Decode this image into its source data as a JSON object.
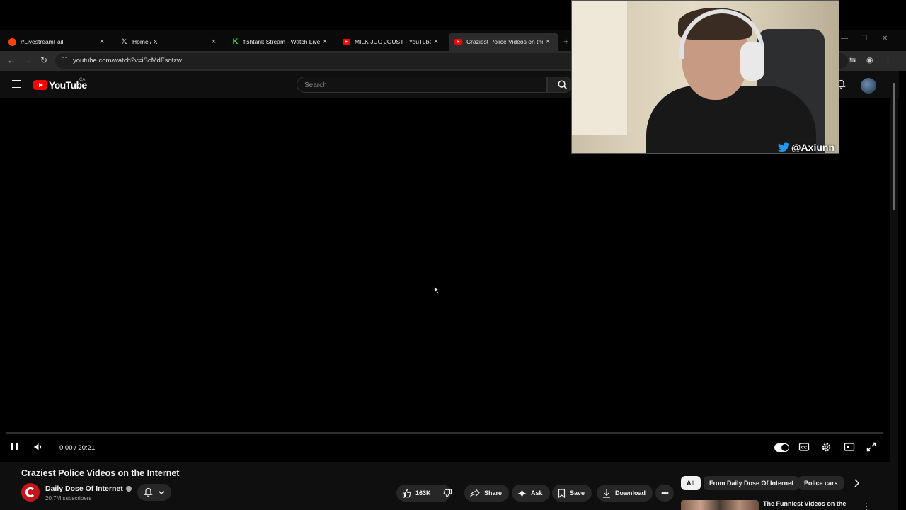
{
  "browser": {
    "tabs": [
      {
        "title": "r/LivestreamFail",
        "favicon": "reddit-icon",
        "color": "#ff4500",
        "active": false
      },
      {
        "title": "Home / X",
        "favicon": "x-icon",
        "color": "#ffffff",
        "active": false
      },
      {
        "title": "fishtank Stream - Watch Live on",
        "favicon": "fishtank-icon",
        "color": "#31d843",
        "active": false
      },
      {
        "title": "MILK JUG JOUST - YouTube",
        "favicon": "youtube-icon",
        "color": "#ff0000",
        "active": false
      },
      {
        "title": "Craziest Police Videos on the Int",
        "favicon": "youtube-icon",
        "color": "#ff0000",
        "active": true
      }
    ],
    "url": "youtube.com/watch?v=iScMdFsotzw"
  },
  "youtube": {
    "logo_text": "YouTube",
    "country_code": "CA",
    "search_placeholder": "Search"
  },
  "player": {
    "current_time": "0:00",
    "duration": "20:21",
    "time_display": "0:00 / 20:21",
    "progress": 0,
    "playing": true,
    "accent": "#ff0000"
  },
  "webcam": {
    "handle": "@Axiunn"
  },
  "video": {
    "title": "Craziest Police Videos on the Internet",
    "channel": "Daily Dose Of Internet",
    "subscribers": "20.7M subscribers",
    "likes": "163K",
    "actions": {
      "share": "Share",
      "ask": "Ask",
      "save": "Save",
      "download": "Download"
    }
  },
  "sidebar": {
    "chips": [
      "All",
      "From Daily Dose Of Internet",
      "Police cars"
    ],
    "suggestion_title": "The Funniest Videos on the"
  }
}
